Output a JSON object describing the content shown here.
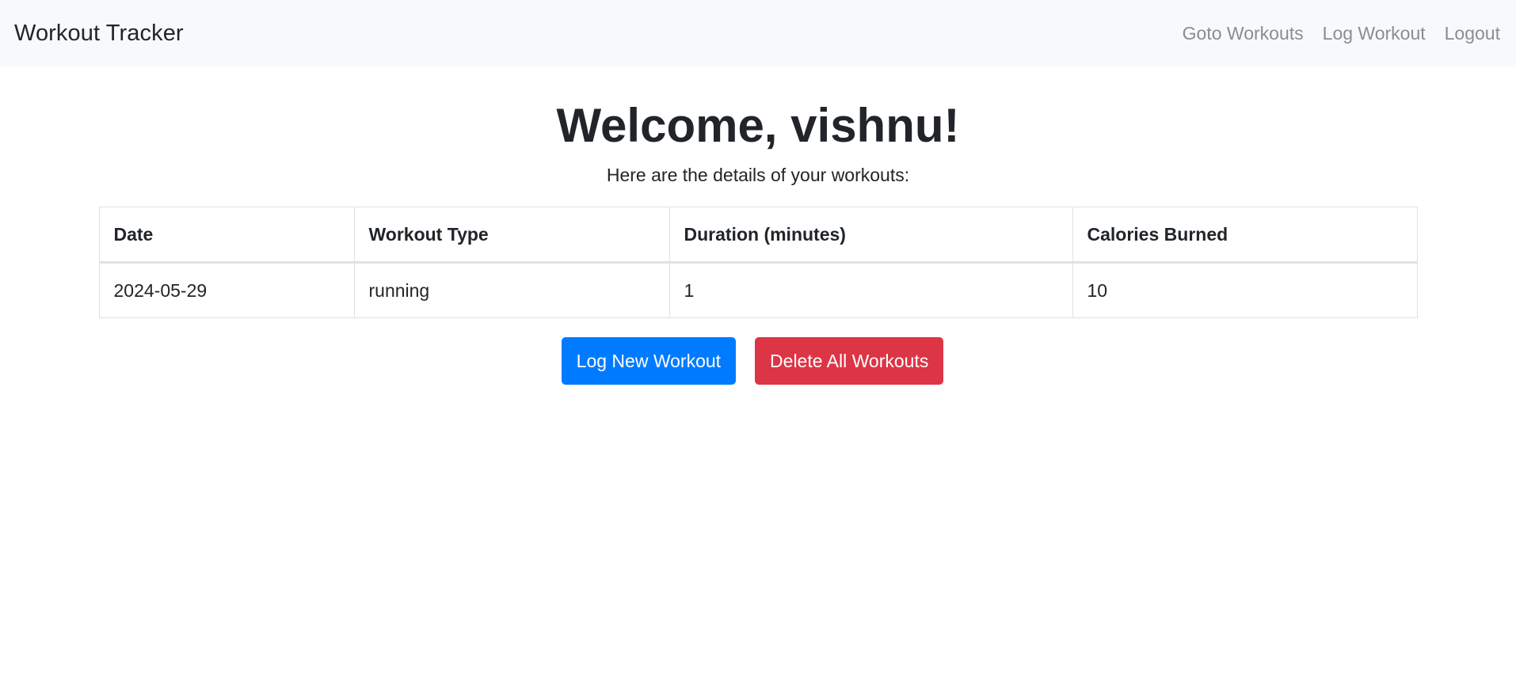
{
  "navbar": {
    "brand": "Workout Tracker",
    "links": [
      "Goto Workouts",
      "Log Workout",
      "Logout"
    ]
  },
  "main": {
    "title": "Welcome, vishnu!",
    "subtitle": "Here are the details of your workouts:"
  },
  "table": {
    "headers": [
      "Date",
      "Workout Type",
      "Duration (minutes)",
      "Calories Burned"
    ],
    "rows": [
      [
        "2024-05-29",
        "running",
        "1",
        "10"
      ]
    ]
  },
  "actions": {
    "log_new": "Log New Workout",
    "delete_all": "Delete All Workouts"
  },
  "colors": {
    "primary": "#007bff",
    "danger": "#dc3545",
    "navbar_bg": "#f8f9fa"
  }
}
